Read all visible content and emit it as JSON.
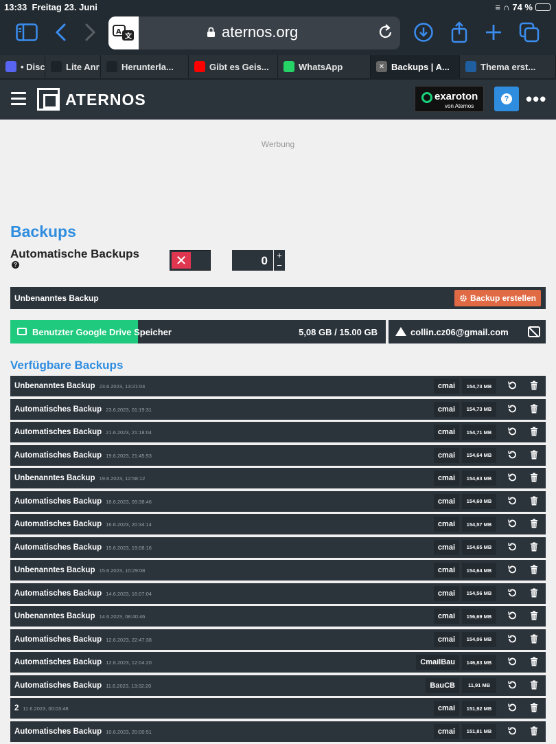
{
  "status_bar": {
    "time": "13:33",
    "date": "Freitag 23. Juni",
    "battery": "74 %"
  },
  "browser": {
    "url": "aternos.org",
    "tabs": [
      {
        "label": "• Disc",
        "icon_color": "#5865f2",
        "icon": "discord-icon",
        "w": 66
      },
      {
        "label": "Lite Anr",
        "icon_color": "#1d2429",
        "icon": "plane-icon",
        "w": 81
      },
      {
        "label": "Herunterla...",
        "icon_color": "#1d2429",
        "icon": "c-icon",
        "w": 128
      },
      {
        "label": "Gibt es Geis...",
        "icon_color": "#ff0000",
        "icon": "youtube-icon",
        "w": 130
      },
      {
        "label": "WhatsApp",
        "icon_color": "#25d366",
        "icon": "whatsapp-icon",
        "w": 135
      },
      {
        "label": "Backups | A...",
        "icon_color": "#555",
        "icon": "aternos-tab-icon",
        "w": 130,
        "active": true
      },
      {
        "label": "Thema erst...",
        "icon_color": "#1f5fa0",
        "icon": "forum-icon",
        "w": 140
      }
    ]
  },
  "header": {
    "brand": "ATERNOS",
    "exaroton_name": "exaroton",
    "exaroton_sub": "von Aternos"
  },
  "ad_label": "Werbung",
  "page_title": "Backups",
  "auto_backups": {
    "label": "Automatische Backups",
    "enabled": false,
    "count": "0",
    "plus": "+",
    "minus": "−"
  },
  "create": {
    "name": "Unbenanntes Backup",
    "button": "Backup erstellen"
  },
  "storage": {
    "label": "Benutzter Google Drive Speicher",
    "used": "5,08 GB / 15.00 GB",
    "fill_fraction": 0.34
  },
  "gdrive_account": "collin.cz06@gmail.com",
  "available_title": "Verfügbare Backups",
  "backups": [
    {
      "name": "Unbenanntes Backup",
      "date": "23.6.2023, 13:21:04",
      "server": "cmai",
      "size": "154,73 MB"
    },
    {
      "name": "Automatisches Backup",
      "date": "23.6.2023, 01:19:31",
      "server": "cmai",
      "size": "154,73 MB"
    },
    {
      "name": "Automatisches Backup",
      "date": "21.6.2023, 21:18:04",
      "server": "cmai",
      "size": "154,71 MB"
    },
    {
      "name": "Automatisches Backup",
      "date": "19.6.2023, 21:45:53",
      "server": "cmai",
      "size": "154,64 MB"
    },
    {
      "name": "Unbenanntes Backup",
      "date": "19.6.2023, 12:58:12",
      "server": "cmai",
      "size": "154,63 MB"
    },
    {
      "name": "Automatisches Backup",
      "date": "18.6.2023, 09:38:46",
      "server": "cmai",
      "size": "154,60 MB"
    },
    {
      "name": "Automatisches Backup",
      "date": "16.6.2023, 20:34:14",
      "server": "cmai",
      "size": "154,57 MB"
    },
    {
      "name": "Automatisches Backup",
      "date": "15.6.2023, 19:08:16",
      "server": "cmai",
      "size": "154,65 MB"
    },
    {
      "name": "Unbenanntes Backup",
      "date": "15.6.2023, 10:29:08",
      "server": "cmai",
      "size": "154,64 MB"
    },
    {
      "name": "Automatisches Backup",
      "date": "14.6.2023, 16:07:04",
      "server": "cmai",
      "size": "154,56 MB"
    },
    {
      "name": "Unbenanntes Backup",
      "date": "14.6.2023, 08:40:46",
      "server": "cmai",
      "size": "156,69 MB"
    },
    {
      "name": "Automatisches Backup",
      "date": "12.6.2023, 22:47:38",
      "server": "cmai",
      "size": "154,06 MB"
    },
    {
      "name": "Automatisches Backup",
      "date": "12.6.2023, 12:04:20",
      "server": "CmailBau",
      "size": "146,83 MB"
    },
    {
      "name": "Automatisches Backup",
      "date": "11.6.2023, 13:02:20",
      "server": "BauCB",
      "size": "11,91 MB"
    },
    {
      "name": "2",
      "date": "11.6.2023, 00:03:48",
      "server": "cmai",
      "size": "151,92 MB"
    },
    {
      "name": "Automatisches Backup",
      "date": "10.6.2023, 20:00:51",
      "server": "cmai",
      "size": "151,81 MB"
    }
  ]
}
